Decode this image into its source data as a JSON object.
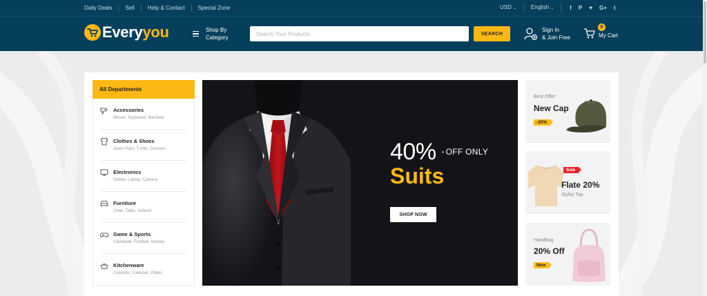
{
  "topbar": {
    "links": [
      "Daily Deals",
      "Sell",
      "Help & Contact",
      "Special Zone"
    ],
    "currency": "USD",
    "language": "English",
    "social": [
      "f",
      "P",
      "♥",
      "G+",
      "t"
    ]
  },
  "header": {
    "logo_part1": "Every",
    "logo_part2": "ou",
    "logo_y": "y",
    "shop_by_line1": "Shop By",
    "shop_by_line2": "Category",
    "search_placeholder": "Search Your Products...",
    "search_button": "SEARCH",
    "signin_line1": "Sign In",
    "signin_line2": "& Join Free",
    "cart_count": "0",
    "cart_label": "My Cart"
  },
  "departments": {
    "title": "All Departments",
    "items": [
      {
        "title": "Accessories",
        "sub": "Mouse, Keyboard, Machine",
        "icon": "hairdryer-icon"
      },
      {
        "title": "Clothes & Shoes",
        "sub": "Jeans Pant, T-shirt, Dresses",
        "icon": "tshirt-icon"
      },
      {
        "title": "Electronics",
        "sub": "Mobile, Laptop, Camera",
        "icon": "monitor-icon"
      },
      {
        "title": "Furniture",
        "sub": "Chair, Table, Sofaset",
        "icon": "sofa-icon"
      },
      {
        "title": "Game & Sports",
        "sub": "Gamepad, Football, Hockey",
        "icon": "gamepad-icon"
      },
      {
        "title": "Kitchenware",
        "sub": "Colander, Cakepan, Plates",
        "icon": "pot-icon"
      }
    ]
  },
  "banner": {
    "percent": "40%",
    "off_text": "OFF ONLY",
    "headline": "Suits",
    "button": "SHOP NOW"
  },
  "promos": [
    {
      "pre": "Best Offer",
      "title": "New Cap",
      "tag": "-20%"
    },
    {
      "tag": "Sale",
      "title": "Flate 20%",
      "sub": "Stylist Top"
    },
    {
      "pre": "Handbag",
      "title": "20% Off",
      "tag": "New"
    }
  ],
  "colors": {
    "navy": "#063f5b",
    "accent": "#fcb913",
    "sale_red": "#e8232e"
  }
}
